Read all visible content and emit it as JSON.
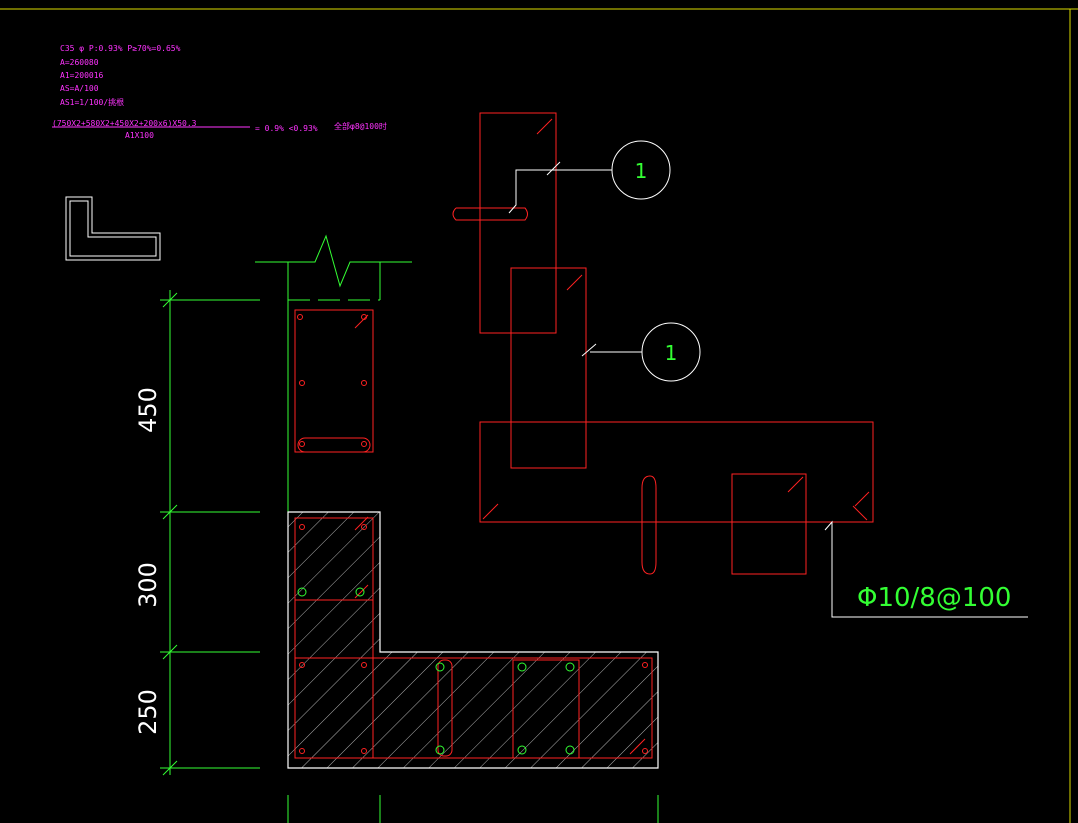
{
  "notes": {
    "line1": "C35  φ  P:0.93%    P≥70%=0.65%",
    "line2": "A=260080",
    "line3": "A1=200016",
    "line4": "AS=A/100",
    "line5": "AS1=1/100/挑根",
    "formula": "(750X2+580X2+450X2+200x6)X50.3",
    "denominator": "A1X100",
    "result": "= 0.9%  <0.93%",
    "note": "全部φ8@100时"
  },
  "dimensions": {
    "d1": "450",
    "d2": "300",
    "d3": "250"
  },
  "callouts": {
    "c1": "1",
    "c2": "1"
  },
  "rebar_label": "Φ10/8@100",
  "colors": {
    "green": "#33ff33",
    "red": "#ff2222",
    "white": "#ffffff",
    "magenta": "#ff33ff",
    "yellow": "#dddd00"
  }
}
